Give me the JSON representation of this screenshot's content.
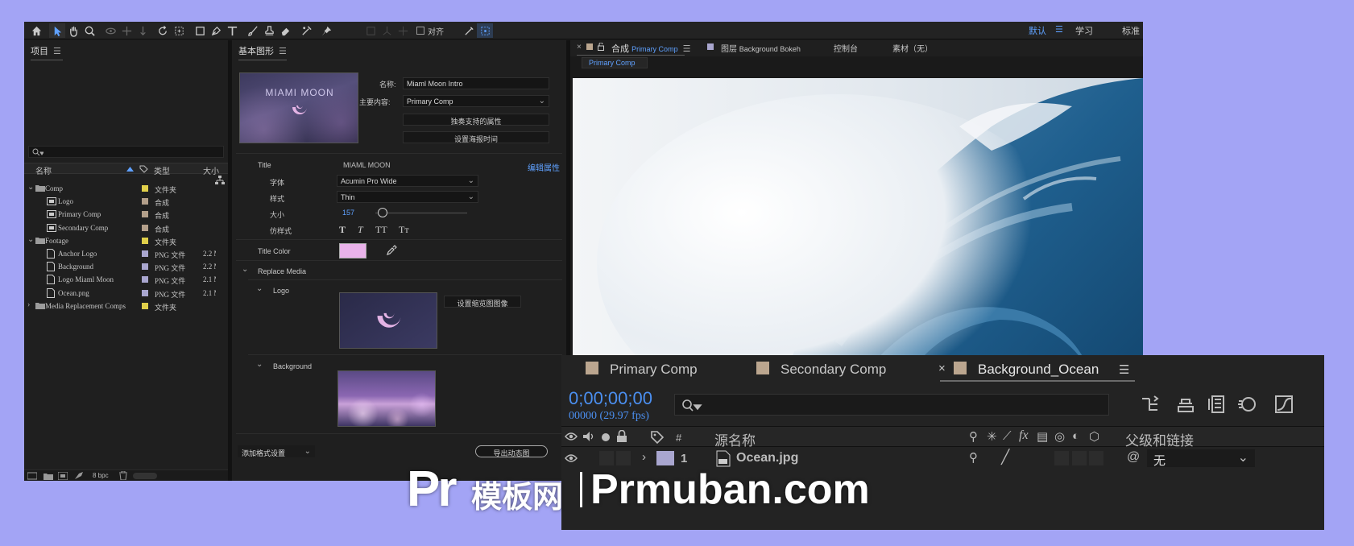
{
  "workspaces": {
    "default": "默认",
    "learn": "学习",
    "standard": "标准"
  },
  "toolbar": {
    "align_label": "对齐"
  },
  "project": {
    "title": "项目",
    "search_placeholder": "",
    "columns": {
      "name": "名称",
      "type": "类型",
      "size": "大小"
    },
    "rows": [
      {
        "name": "Comp",
        "type": "文件夹",
        "size": "",
        "kind": "folder",
        "color": "#e0cf4a"
      },
      {
        "name": "Logo",
        "type": "合成",
        "size": "",
        "kind": "comp",
        "color": "#b39f8a"
      },
      {
        "name": "Primary Comp",
        "type": "合成",
        "size": "",
        "kind": "comp",
        "color": "#b39f8a"
      },
      {
        "name": "Secondary Comp",
        "type": "合成",
        "size": "",
        "kind": "comp",
        "color": "#b39f8a"
      },
      {
        "name": "Footage",
        "type": "文件夹",
        "size": "",
        "kind": "folder",
        "color": "#e0cf4a"
      },
      {
        "name": "Anchor Logo",
        "type": "PNG 文件",
        "size": "2.2 M",
        "kind": "file",
        "color": "#a9a6cf"
      },
      {
        "name": "Background",
        "type": "PNG 文件",
        "size": "2.2 M",
        "kind": "file",
        "color": "#a9a6cf"
      },
      {
        "name": "Logo Miaml Moon",
        "type": "PNG 文件",
        "size": "2.1 M",
        "kind": "file",
        "color": "#a9a6cf"
      },
      {
        "name": "Ocean.png",
        "type": "PNG 文件",
        "size": "2.1 M",
        "kind": "file",
        "color": "#a9a6cf"
      },
      {
        "name": "Media Replacement Comps",
        "type": "文件夹",
        "size": "",
        "kind": "folder",
        "color": "#e0cf4a"
      }
    ],
    "bpc": "8 bpc"
  },
  "eg": {
    "title": "基本图形",
    "preview_text": "MIAMI MOON",
    "name_label": "名称:",
    "name_value": "Miaml Moon Intro",
    "master_label": "主要内容:",
    "master_value": "Primary Comp",
    "solo_button": "独奏支持的属性",
    "poster_button": "设置海报时间",
    "title_label": "Title",
    "title_value": "MIAML MOON",
    "edit_props": "编辑属性",
    "font_label": "字体",
    "font_value": "Acumin Pro Wide",
    "style_label": "样式",
    "style_value": "Thin",
    "size_label": "大小",
    "size_value": "157",
    "size_slider": 0.08,
    "faux_label": "仿样式",
    "faux_t1": "T",
    "faux_t2": "T",
    "faux_t3": "TT",
    "faux_t4": "Tт",
    "title_color_label": "Title Color",
    "title_color": "#e9b2ea",
    "replace_media": "Replace Media",
    "logo_label": "Logo",
    "thumb_button": "设置缩览图图像",
    "background_label": "Background",
    "add_format": "添加格式设置",
    "export": "导出动态图"
  },
  "viewer": {
    "tabs": [
      {
        "prefix": "合成",
        "name": "Primary Comp"
      },
      {
        "prefix": "图层",
        "name": "Background Bokeh"
      },
      {
        "prefix": "",
        "name": "控制台"
      },
      {
        "prefix": "",
        "name": "素材（无）"
      }
    ],
    "subtab": "Primary Comp"
  },
  "timeline": {
    "tabs": [
      "Primary Comp",
      "Secondary Comp",
      "Background_Ocean"
    ],
    "timecode": "0;00;00;00",
    "frames": "00000 (29.97 fps)",
    "columns": {
      "hash": "#",
      "source": "源名称",
      "fx": "fx",
      "parent": "父级和链接"
    },
    "layer": {
      "index": "1",
      "name": "Ocean.jpg",
      "parent": "无"
    }
  },
  "watermark": {
    "brand": "Pr",
    "cn": "模板网",
    "url": "Prmuban.com"
  },
  "colors": {
    "accent": "#5fa1ff",
    "timecode": "#4b8ff0",
    "comp_swatch": "#bba68f",
    "footage_swatch": "#a9a6cf",
    "folder_swatch": "#e0cf4a"
  }
}
